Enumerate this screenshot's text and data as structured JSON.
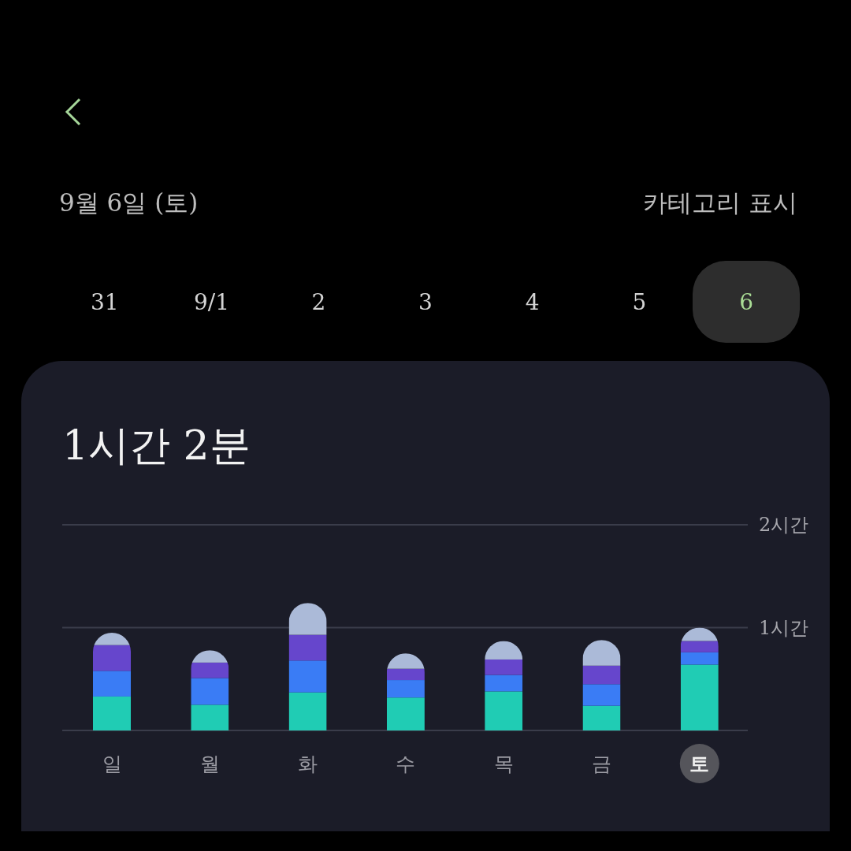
{
  "header": {
    "date": "9월 6일 (토)",
    "action": "카테고리 표시"
  },
  "days": [
    {
      "label": "31",
      "selected": false
    },
    {
      "label": "9/1",
      "selected": false
    },
    {
      "label": "2",
      "selected": false
    },
    {
      "label": "3",
      "selected": false
    },
    {
      "label": "4",
      "selected": false
    },
    {
      "label": "5",
      "selected": false
    },
    {
      "label": "6",
      "selected": true
    }
  ],
  "usage": {
    "total": "1시간 2분",
    "chart_data": {
      "type": "bar",
      "stacked": true,
      "categories": [
        "일",
        "월",
        "화",
        "수",
        "목",
        "금",
        "토"
      ],
      "ylim": [
        0,
        2
      ],
      "yticks": [
        {
          "value": 1,
          "label": "1시간"
        },
        {
          "value": 2,
          "label": "2시간"
        }
      ],
      "series": [
        {
          "color": "#20ccb4",
          "values": [
            0.33,
            0.25,
            0.37,
            0.32,
            0.38,
            0.24,
            0.64
          ]
        },
        {
          "color": "#3a7cf5",
          "values": [
            0.25,
            0.26,
            0.31,
            0.17,
            0.16,
            0.21,
            0.12
          ]
        },
        {
          "color": "#6646cc",
          "values": [
            0.25,
            0.15,
            0.25,
            0.11,
            0.15,
            0.18,
            0.11
          ]
        },
        {
          "color": "#abbad8",
          "values": [
            0.12,
            0.12,
            0.31,
            0.15,
            0.18,
            0.25,
            0.13
          ]
        }
      ]
    },
    "day_selected": [
      false,
      false,
      false,
      false,
      false,
      false,
      true
    ]
  }
}
